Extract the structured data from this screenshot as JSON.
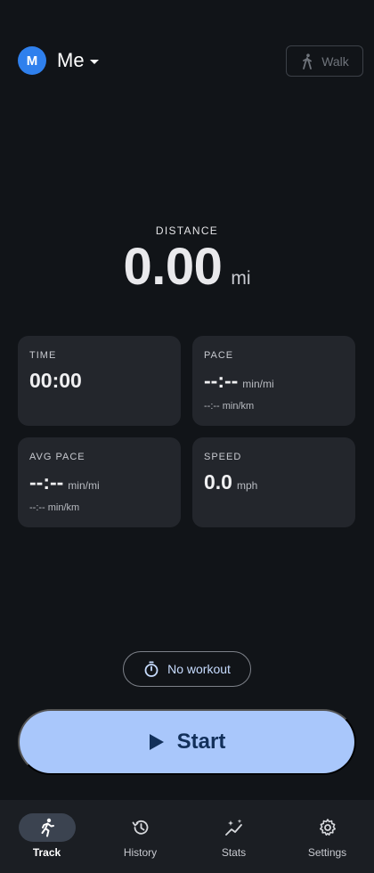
{
  "header": {
    "avatar_initial": "M",
    "profile_name": "Me",
    "walk_label": "Walk"
  },
  "distance": {
    "label": "DISTANCE",
    "value": "0.00",
    "unit": "mi"
  },
  "cards": {
    "time": {
      "label": "TIME",
      "value": "00:00"
    },
    "pace": {
      "label": "PACE",
      "value": "--:--",
      "unit": "min/mi",
      "sub": "--:-- min/km"
    },
    "avg_pace": {
      "label": "AVG PACE",
      "value": "--:--",
      "unit": "min/mi",
      "sub": "--:-- min/km"
    },
    "speed": {
      "label": "SPEED",
      "value": "0.0",
      "unit": "mph"
    }
  },
  "workout_label": "No workout",
  "start_label": "Start",
  "nav": {
    "track": "Track",
    "history": "History",
    "stats": "Stats",
    "settings": "Settings"
  },
  "icons": {
    "walk": "walking-person-icon",
    "workout": "timer-icon",
    "start": "play-icon",
    "track": "running-person-icon",
    "history": "history-icon",
    "stats": "sparkle-chart-icon",
    "settings": "gear-icon"
  },
  "colors": {
    "background": "#111418",
    "card": "#23262c",
    "accent": "#a9c7fb",
    "avatar": "#2f80ed",
    "nav_active": "#3b4350"
  }
}
